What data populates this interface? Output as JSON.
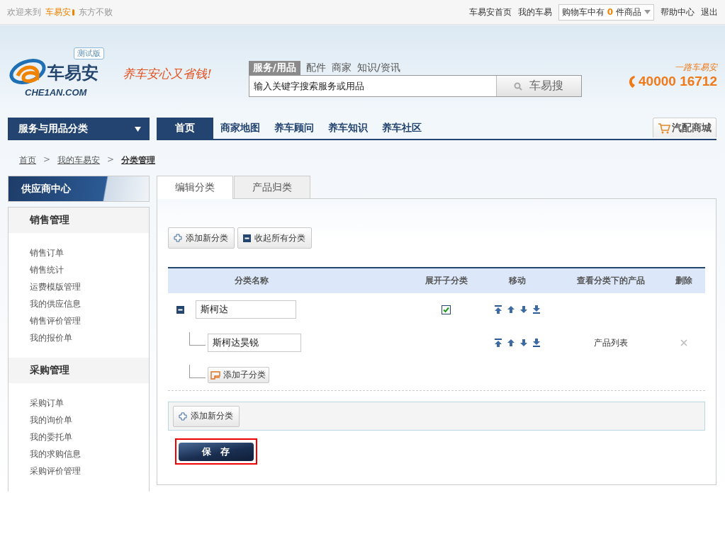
{
  "top_bar": {
    "welcome": "欢迎来到",
    "site_name": "车易安",
    "user": "东方不败",
    "links": [
      "车易安首页",
      "我的车易"
    ],
    "cart": {
      "prefix": "购物车中有",
      "count": "0",
      "suffix": "件商品"
    },
    "right_links": [
      "帮助中心",
      "退出"
    ]
  },
  "header": {
    "logo": {
      "name": "车易安",
      "domain": "CHE1AN.COM",
      "badge": "测试版"
    },
    "slogan": "养车安心又省钱!",
    "search": {
      "tabs": [
        {
          "label": "服务/用品",
          "selected": true
        },
        {
          "label": "配件",
          "selected": false
        },
        {
          "label": "商家",
          "selected": false
        },
        {
          "label": "知识/资讯",
          "selected": false
        }
      ],
      "placeholder": "输入关键字搜索服务或用品",
      "button": "车易搜"
    },
    "hotline": {
      "caption": "一路车易安",
      "number": "40000 16712"
    }
  },
  "nav": {
    "category_menu": "服务与用品分类",
    "items": [
      {
        "label": "首页",
        "selected": true
      },
      {
        "label": "商家地图",
        "selected": false
      },
      {
        "label": "养车顾问",
        "selected": false
      },
      {
        "label": "养车知识",
        "selected": false
      },
      {
        "label": "养车社区",
        "selected": false
      }
    ],
    "shop_link": "汽配商城"
  },
  "breadcrumb": {
    "items": [
      "首页",
      "我的车易安",
      "分类管理"
    ],
    "separators": [
      ">",
      ">"
    ]
  },
  "sidebar": {
    "title": "供应商中心",
    "sections": [
      {
        "title": "销售管理",
        "items": [
          "销售订单",
          "销售统计",
          "运费模版管理",
          "我的供应信息",
          "销售评价管理",
          "我的报价单"
        ]
      },
      {
        "title": "采购管理",
        "items": [
          "采购订单",
          "我的询价单",
          "我的委托单",
          "我的求购信息",
          "采购评价管理"
        ]
      }
    ]
  },
  "editor": {
    "tabs": [
      {
        "label": "编辑分类",
        "selected": true
      },
      {
        "label": "产品归类",
        "selected": false
      }
    ],
    "toolbar": [
      "添加新分类",
      "收起所有分类"
    ],
    "table": {
      "columns": [
        "分类名称",
        "展开子分类",
        "移动",
        "查看分类下的产品",
        "删除"
      ],
      "categories": [
        {
          "name": "斯柯达",
          "expanded": true,
          "show_subcategories": true,
          "children": [
            {
              "name": "斯柯达昊锐",
              "products_link": "产品列表"
            }
          ],
          "add_child": "添加子分类"
        }
      ]
    },
    "add_button": "添加新分类",
    "save_button": {
      "label": "保　存",
      "highlighted": true
    }
  }
}
